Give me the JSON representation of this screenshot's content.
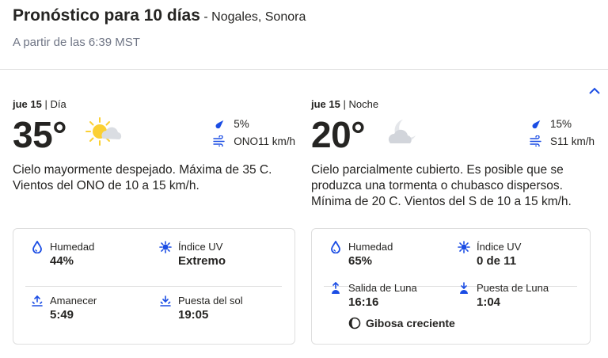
{
  "header": {
    "title": "Pronóstico para 10 días",
    "location": "- Nogales, Sonora",
    "as_of": "A partir de las 6:39 MST"
  },
  "day": {
    "date": "jue 15",
    "period": "Día",
    "temp": "35°",
    "precip": "5%",
    "wind": "ONO11 km/h",
    "narrative": "Cielo mayormente despejado. Máxima de 35 C. Vientos del ONO de 10 a 15 km/h.",
    "details": {
      "humidity_label": "Humedad",
      "humidity_value": "44%",
      "uv_label": "Índice UV",
      "uv_value": "Extremo",
      "sunrise_label": "Amanecer",
      "sunrise_value": "5:49",
      "sunset_label": "Puesta del sol",
      "sunset_value": "19:05"
    },
    "icon": "mostly-sunny-icon"
  },
  "night": {
    "date": "jue 15",
    "period": "Noche",
    "temp": "20°",
    "precip": "15%",
    "wind": "S11 km/h",
    "narrative": "Cielo parcialmente cubierto. Es posible que se produzca una tormenta o chubasco dispersos. Mínima de 20 C. Vientos del S de 10 a 15 km/h.",
    "details": {
      "humidity_label": "Humedad",
      "humidity_value": "65%",
      "uv_label": "Índice UV",
      "uv_value": "0 de 11",
      "moonrise_label": "Salida de Luna",
      "moonrise_value": "16:16",
      "moonset_label": "Puesta de Luna",
      "moonset_value": "1:04",
      "moon_phase": "Gibosa creciente"
    },
    "icon": "partly-cloudy-night-icon"
  },
  "colors": {
    "accent_blue": "#1b4de4",
    "sun_yellow": "#fbd033",
    "text": "#252422",
    "muted": "#6f7585",
    "border": "#dedede"
  }
}
